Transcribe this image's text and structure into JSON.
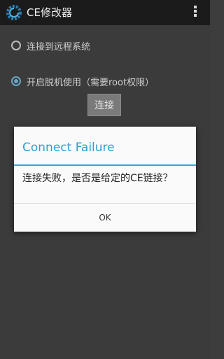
{
  "app": {
    "title": "CE修改器",
    "icon": "ce-gear-icon",
    "menu_icon": "overflow-menu-icon"
  },
  "options": [
    {
      "label": "连接到远程系统",
      "checked": false
    },
    {
      "label": "开启脱机使用（需要root权限）",
      "checked": true
    }
  ],
  "connect_button": {
    "label": "连接"
  },
  "dialog": {
    "title": "Connect Failure",
    "message": "连接失败，是否是给定的CE链接？",
    "ok_label": "OK"
  },
  "colors": {
    "accent": "#2f9fd0",
    "action_bar": "#1b1b1b",
    "dim_background": "#3b3b3b"
  }
}
